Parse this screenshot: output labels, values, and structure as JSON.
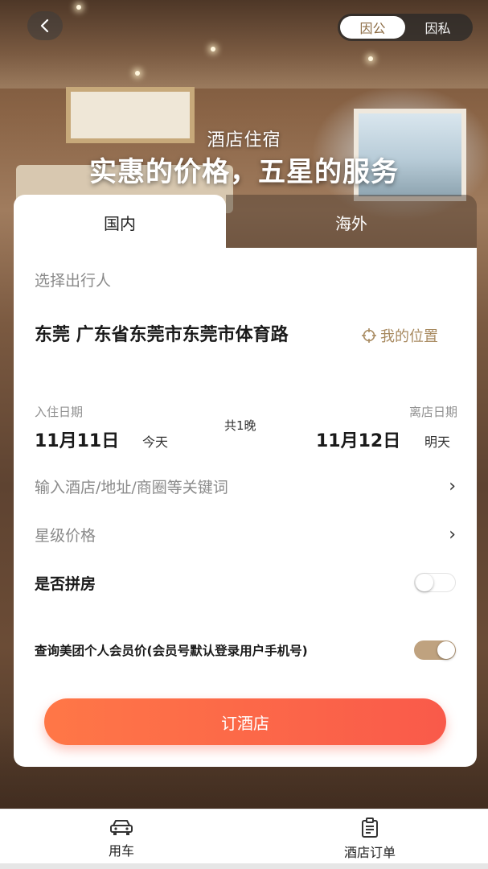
{
  "header": {
    "back_icon": "chevron-left-icon",
    "toggle": {
      "options": [
        "因公",
        "因私"
      ],
      "selected": "因公"
    }
  },
  "hero": {
    "subtitle": "酒店住宿",
    "title": "实惠的价格，五星的服务"
  },
  "tabs": [
    {
      "label": "国内",
      "active": true
    },
    {
      "label": "海外",
      "active": false
    }
  ],
  "form": {
    "traveler_placeholder": "选择出行人",
    "location": "东莞 广东省东莞市东莞市体育路",
    "my_location_label": "我的位置",
    "checkin": {
      "label": "入住日期",
      "date": "11月11日",
      "relative": "今天"
    },
    "nights": "共1晚",
    "checkout": {
      "label": "离店日期",
      "date": "11月12日",
      "relative": "明天"
    },
    "keyword_placeholder": "输入酒店/地址/商圈等关键词",
    "star_price_label": "星级价格",
    "share_room": {
      "label": "是否拼房",
      "on": false
    },
    "member_price": {
      "label": "查询美团个人会员价(会员号默认登录用户手机号)",
      "on": true
    },
    "book_button": "订酒店"
  },
  "bottom_nav": [
    {
      "label": "用车",
      "icon": "car-icon"
    },
    {
      "label": "酒店订单",
      "icon": "clipboard-icon"
    }
  ],
  "colors": {
    "accent_gold": "#a88a60",
    "button_gradient_start": "#ff7747",
    "button_gradient_end": "#f95a4a",
    "switch_on": "#bfa27f"
  }
}
